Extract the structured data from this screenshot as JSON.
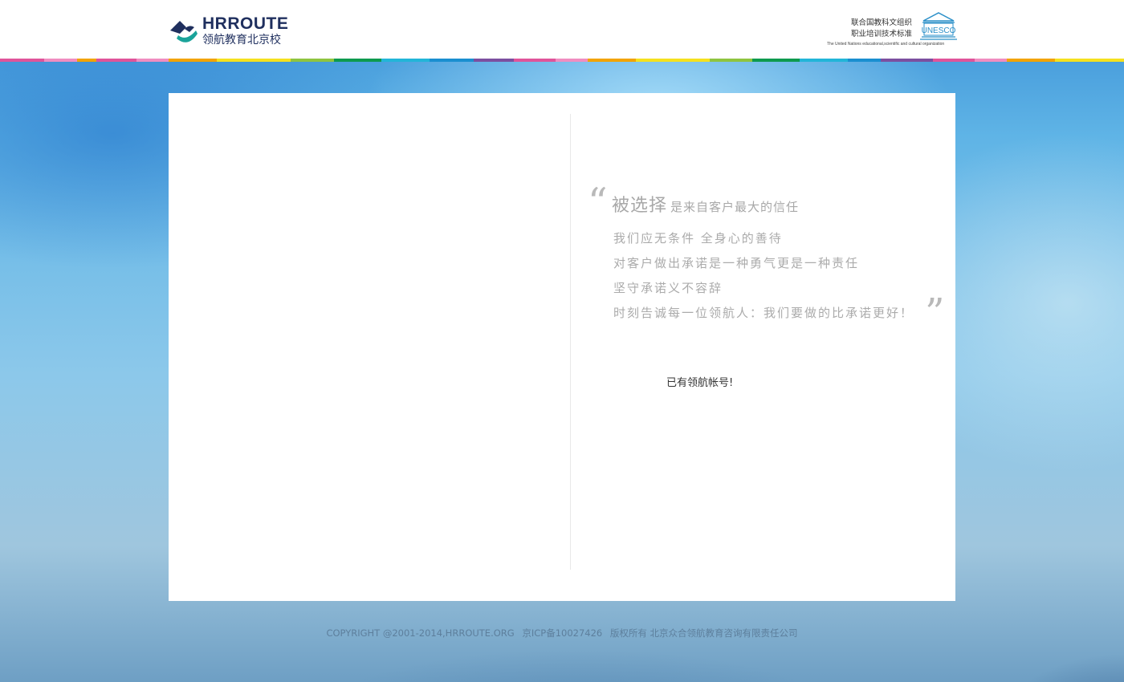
{
  "header": {
    "logo_en": "HRROUTE",
    "logo_cn": "领航教育北京校",
    "unesco_line1": "联合国教科文组织",
    "unesco_line2": "职业培训技术标准",
    "unesco_sub": "The United Nations educational,scientific and cultural organization",
    "unesco_icon_text": "UNESCO"
  },
  "slogan": {
    "head_big": "被选择",
    "head_small": "是来自客户最大的信任",
    "lines": [
      "我们应无条件 全身心的善待",
      "对客户做出承诺是一种勇气更是一种责任",
      "坚守承诺义不容辞",
      "时刻告诚每一位领航人：我们要做的比承诺更好！"
    ]
  },
  "account": {
    "link_label": "已有领航帐号!"
  },
  "footer": {
    "copyright": "COPYRIGHT @2001-2014,HRROUTE.ORG",
    "icp": "京ICP备10027426",
    "rights": "版权所有 北京众合领航教育咨询有限责任公司"
  },
  "colors": {
    "brand_navy": "#1f2f5e",
    "brand_teal": "#1aa39a",
    "slogan_gray": "#a8a8a8",
    "unesco_blue": "#2a8fc8"
  },
  "icons": [
    "logo-mark-icon",
    "unesco-temple-icon",
    "quote-open-icon",
    "quote-close-icon"
  ]
}
